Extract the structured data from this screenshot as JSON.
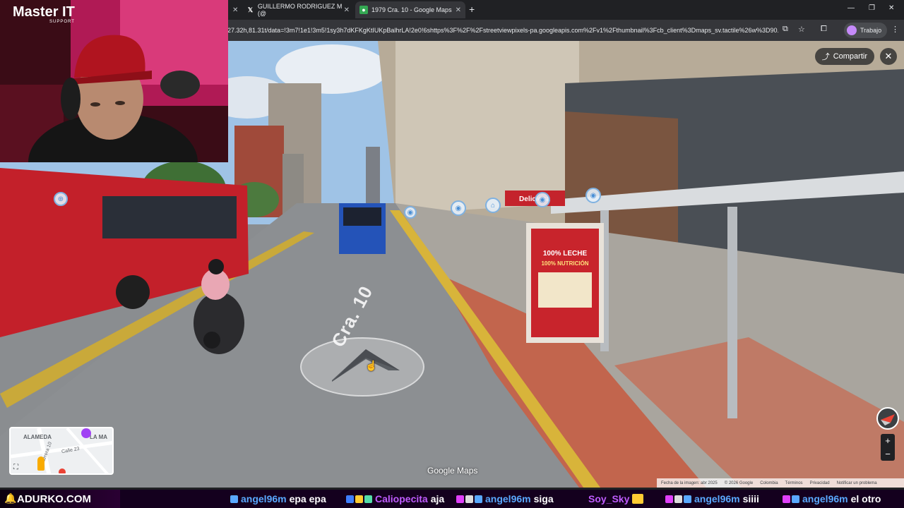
{
  "browser": {
    "tabs": [
      {
        "title": "",
        "active": false
      },
      {
        "title": "GUILLERMO RODRIGUEZ M (@",
        "active": false,
        "icon": "x-logo"
      },
      {
        "title": "1979 Cra. 10 - Google Maps",
        "active": true,
        "icon": "google-maps"
      }
    ],
    "address": "27.32h,81.31t/data=!3m7!1e1!3m5!1sy3h7dKFKgKtIUKpBalhrLA!2e0!6shttps%3F%2F%2Fstreetviewpixels-pa.googleapis.com%2Fv1%2Fthumbnail%3Fcb_client%3Dmaps_sv.tactile%26w%3D90...",
    "profile": "Trabajo"
  },
  "streetview": {
    "share_label": "Compartir",
    "street_name": "Cra. 10",
    "logo": "Google Maps",
    "attribution": {
      "date": "Fecha de la imagen: abr 2025",
      "copyright": "© 2026 Google",
      "country": "Colombia",
      "terms": "Términos",
      "privacy": "Privacidad",
      "report": "Notificar un problema"
    },
    "ad": {
      "headline": "100% LECHE",
      "subline": "100% NUTRICIÓN"
    },
    "shop_sign": "Deliciosa",
    "minimap": {
      "label1": "ALAMEDA",
      "label2": "LA MA",
      "street1": "Carrera 10",
      "street2": "Calle 23"
    },
    "zoom_in": "+",
    "zoom_out": "−"
  },
  "stream": {
    "logo": "Master IT",
    "logo_sub": "SUPPORT",
    "brand": "ADURKO.COM"
  },
  "chat": [
    {
      "user": "angel96m",
      "text": "epa epa",
      "color": "#5aa9ff"
    },
    {
      "user": "Caliopecita",
      "text": "aja",
      "color": "#c05cff"
    },
    {
      "user": "angel96m",
      "text": "siga",
      "color": "#5aa9ff"
    },
    {
      "user": "Soy_Sky",
      "text": "",
      "color": "#c05cff"
    },
    {
      "user": "angel96m",
      "text": "siiii",
      "color": "#5aa9ff"
    },
    {
      "user": "angel96m",
      "text": "el otro",
      "color": "#5aa9ff"
    }
  ]
}
